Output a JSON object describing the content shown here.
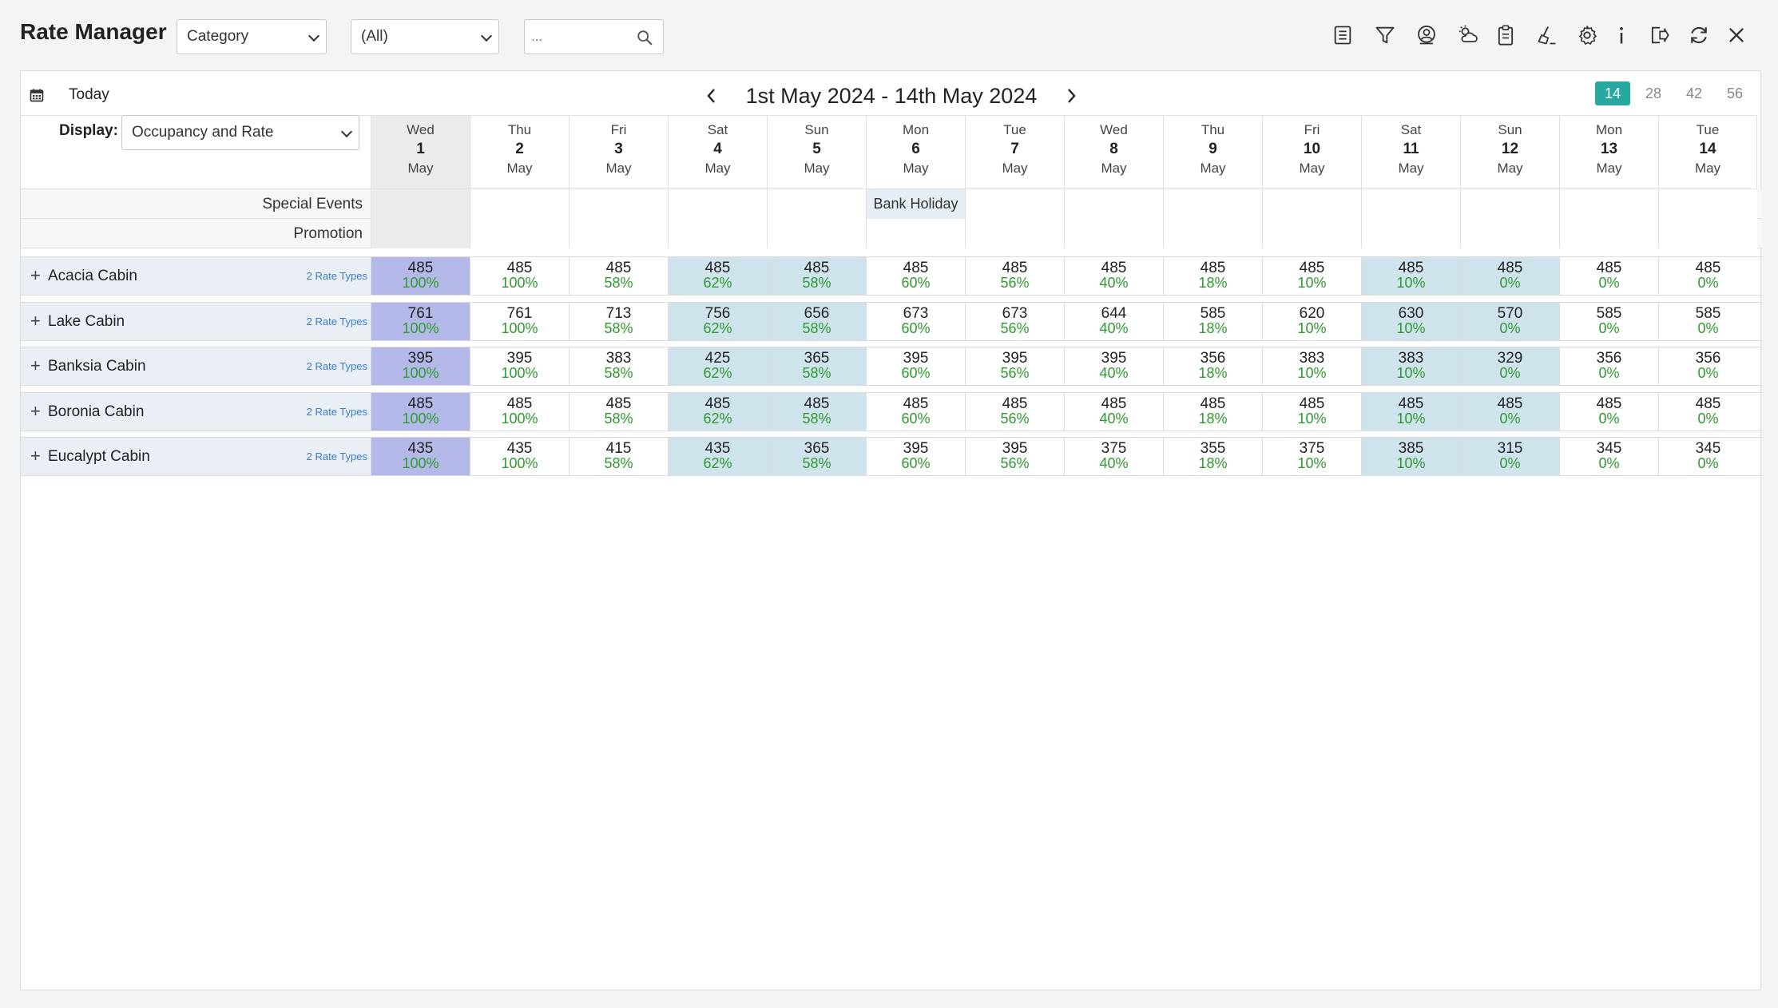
{
  "app": {
    "title": "Rate Manager"
  },
  "filters": {
    "category": "Category",
    "all": "(All)",
    "search_placeholder": "..."
  },
  "toolbar_icons": [
    "report-icon",
    "filter-icon",
    "guest-icon",
    "weather-icon",
    "clipboard-icon",
    "broom-icon",
    "gear-icon",
    "info-icon",
    "logout-icon",
    "refresh-icon",
    "close-icon"
  ],
  "nav": {
    "today": "Today",
    "range": "1st May 2024 - 14th May 2024",
    "spans": [
      "14",
      "28",
      "42",
      "56"
    ],
    "active_span": "14"
  },
  "display": {
    "label": "Display:",
    "value": "Occupancy and Rate"
  },
  "days": [
    {
      "dow": "Wed",
      "num": "1",
      "mon": "May"
    },
    {
      "dow": "Thu",
      "num": "2",
      "mon": "May"
    },
    {
      "dow": "Fri",
      "num": "3",
      "mon": "May"
    },
    {
      "dow": "Sat",
      "num": "4",
      "mon": "May"
    },
    {
      "dow": "Sun",
      "num": "5",
      "mon": "May"
    },
    {
      "dow": "Mon",
      "num": "6",
      "mon": "May"
    },
    {
      "dow": "Tue",
      "num": "7",
      "mon": "May"
    },
    {
      "dow": "Wed",
      "num": "8",
      "mon": "May"
    },
    {
      "dow": "Thu",
      "num": "9",
      "mon": "May"
    },
    {
      "dow": "Fri",
      "num": "10",
      "mon": "May"
    },
    {
      "dow": "Sat",
      "num": "11",
      "mon": "May"
    },
    {
      "dow": "Sun",
      "num": "12",
      "mon": "May"
    },
    {
      "dow": "Mon",
      "num": "13",
      "mon": "May"
    },
    {
      "dow": "Tue",
      "num": "14",
      "mon": "May"
    }
  ],
  "info_rows": {
    "special_events": {
      "label": "Special Events",
      "cells": [
        "",
        "",
        "",
        "",
        "",
        "Bank Holiday",
        "",
        "",
        "",
        "",
        "",
        "",
        "",
        ""
      ]
    },
    "promotion": {
      "label": "Promotion",
      "cells": [
        "",
        "",
        "",
        "",
        "",
        "",
        "",
        "",
        "",
        "",
        "",
        "",
        "",
        ""
      ]
    }
  },
  "occupancy": [
    "100%",
    "100%",
    "58%",
    "62%",
    "58%",
    "60%",
    "56%",
    "40%",
    "18%",
    "10%",
    "10%",
    "0%",
    "0%",
    "0%"
  ],
  "cabins": [
    {
      "name": "Acacia Cabin",
      "rate_types": "2 Rate Types",
      "rates": [
        "485",
        "485",
        "485",
        "485",
        "485",
        "485",
        "485",
        "485",
        "485",
        "485",
        "485",
        "485",
        "485",
        "485"
      ]
    },
    {
      "name": "Lake Cabin",
      "rate_types": "2 Rate Types",
      "rates": [
        "761",
        "761",
        "713",
        "756",
        "656",
        "673",
        "673",
        "644",
        "585",
        "620",
        "630",
        "570",
        "585",
        "585"
      ]
    },
    {
      "name": "Banksia Cabin",
      "rate_types": "2 Rate Types",
      "rates": [
        "395",
        "395",
        "383",
        "425",
        "365",
        "395",
        "395",
        "395",
        "356",
        "383",
        "383",
        "329",
        "356",
        "356"
      ]
    },
    {
      "name": "Boronia Cabin",
      "rate_types": "2 Rate Types",
      "rates": [
        "485",
        "485",
        "485",
        "485",
        "485",
        "485",
        "485",
        "485",
        "485",
        "485",
        "485",
        "485",
        "485",
        "485"
      ]
    },
    {
      "name": "Eucalypt Cabin",
      "rate_types": "2 Rate Types",
      "rates": [
        "435",
        "435",
        "415",
        "435",
        "365",
        "395",
        "395",
        "375",
        "355",
        "375",
        "385",
        "315",
        "345",
        "345"
      ]
    }
  ],
  "colors": {
    "accent": "#27a9a1",
    "today_cell": "#b3b8e8",
    "weekend_cell": "#cfe3ec",
    "occupancy_text": "#2f9a2f",
    "rate_types_link": "#3a7bc8"
  }
}
